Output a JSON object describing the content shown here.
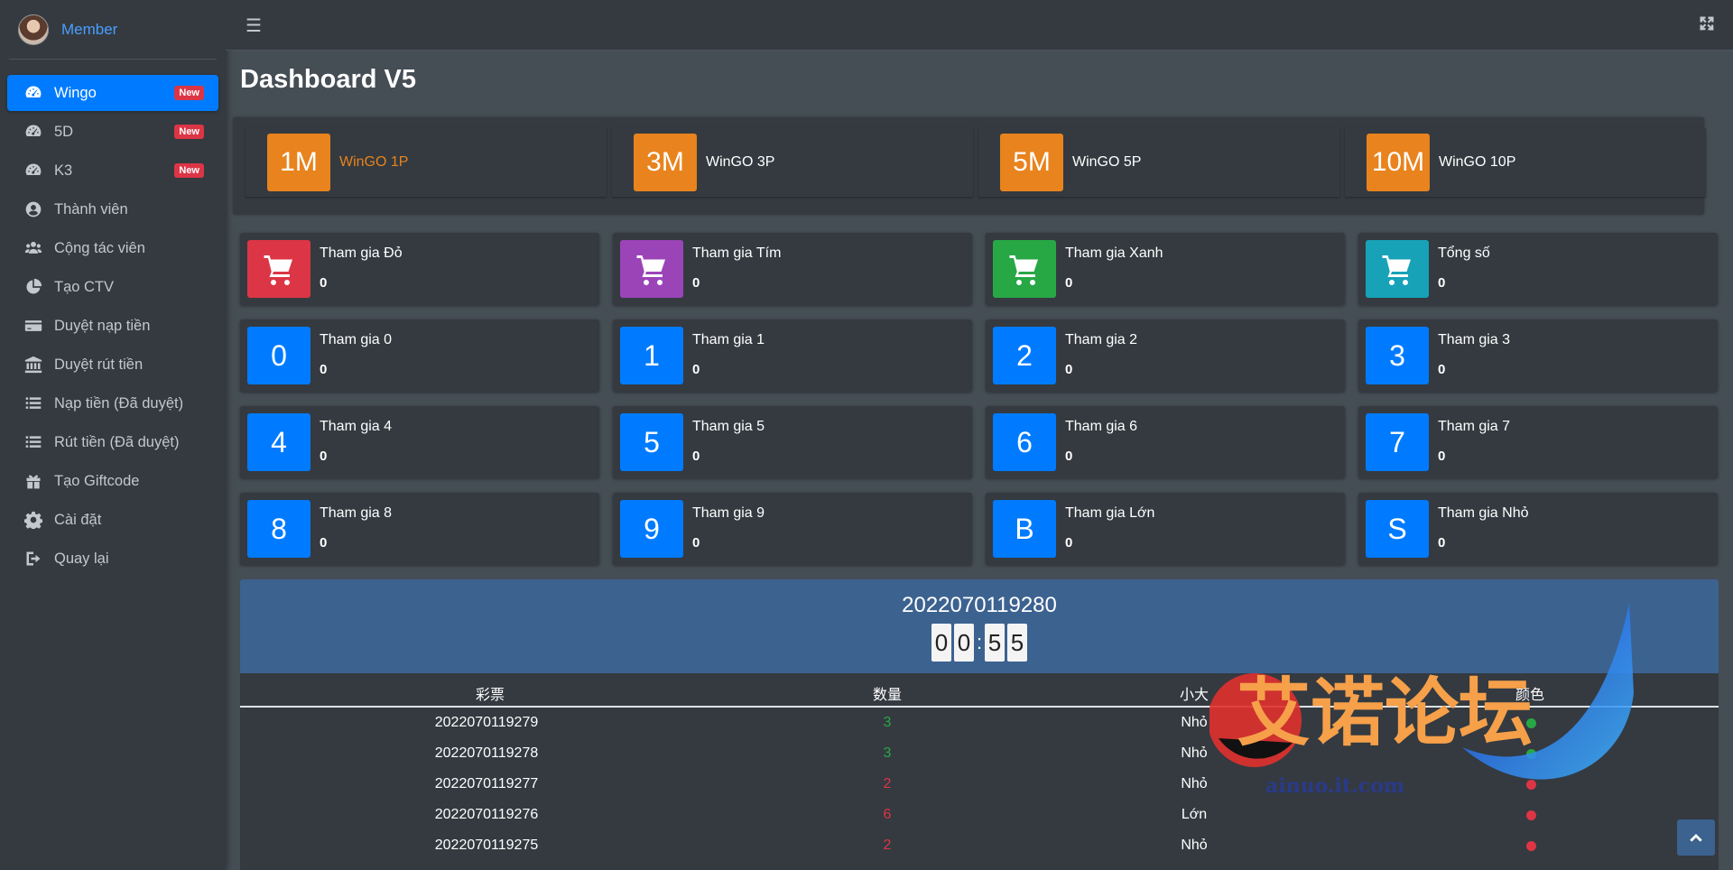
{
  "sidebar": {
    "user_name": "Member",
    "items": [
      {
        "label": "Wingo",
        "badge": "New",
        "icon": "dashboard-icon"
      },
      {
        "label": "5D",
        "badge": "New",
        "icon": "dashboard-icon"
      },
      {
        "label": "K3",
        "badge": "New",
        "icon": "dashboard-icon"
      },
      {
        "label": "Thành viên",
        "icon": "user-circle-icon"
      },
      {
        "label": "Cộng tác viên",
        "icon": "users-icon"
      },
      {
        "label": "Tạo CTV",
        "icon": "pie-chart-icon"
      },
      {
        "label": "Duyệt nạp tiền",
        "icon": "credit-card-icon"
      },
      {
        "label": "Duyệt rút tiền",
        "icon": "bank-icon"
      },
      {
        "label": "Nạp tiền (Đã duyệt)",
        "icon": "list-icon"
      },
      {
        "label": "Rút tiền (Đã duyệt)",
        "icon": "list-icon"
      },
      {
        "label": "Tạo Giftcode",
        "icon": "gift-icon"
      },
      {
        "label": "Cài đặt",
        "icon": "gear-icon"
      },
      {
        "label": "Quay lại",
        "icon": "sign-out-icon"
      }
    ]
  },
  "page": {
    "title": "Dashboard V5"
  },
  "games": [
    {
      "box": "1M",
      "label": "WinGO 1P",
      "active": true
    },
    {
      "box": "3M",
      "label": "WinGO 3P",
      "active": false
    },
    {
      "box": "5M",
      "label": "WinGO 5P",
      "active": false
    },
    {
      "box": "10M",
      "label": "WinGO 10P",
      "active": false
    }
  ],
  "color_cards": [
    {
      "title": "Tham gia Đỏ",
      "value": "0",
      "color": "#dc3545"
    },
    {
      "title": "Tham gia Tím",
      "value": "0",
      "color": "#9b44b8"
    },
    {
      "title": "Tham gia Xanh",
      "value": "0",
      "color": "#28a745"
    },
    {
      "title": "Tổng số",
      "value": "0",
      "color": "#17a2b8"
    }
  ],
  "number_cards": [
    {
      "box": "0",
      "title": "Tham gia 0",
      "value": "0"
    },
    {
      "box": "1",
      "title": "Tham gia 1",
      "value": "0"
    },
    {
      "box": "2",
      "title": "Tham gia 2",
      "value": "0"
    },
    {
      "box": "3",
      "title": "Tham gia 3",
      "value": "0"
    },
    {
      "box": "4",
      "title": "Tham gia 4",
      "value": "0"
    },
    {
      "box": "5",
      "title": "Tham gia 5",
      "value": "0"
    },
    {
      "box": "6",
      "title": "Tham gia 6",
      "value": "0"
    },
    {
      "box": "7",
      "title": "Tham gia 7",
      "value": "0"
    },
    {
      "box": "8",
      "title": "Tham gia 8",
      "value": "0"
    },
    {
      "box": "9",
      "title": "Tham gia 9",
      "value": "0"
    },
    {
      "box": "B",
      "title": "Tham gia Lớn",
      "value": "0"
    },
    {
      "box": "S",
      "title": "Tham gia Nhỏ",
      "value": "0"
    }
  ],
  "round": {
    "number": "2022070119280",
    "timer": [
      "0",
      "0",
      "5",
      "5"
    ]
  },
  "table": {
    "headers": [
      "彩票",
      "数量",
      "小大",
      "颜色"
    ],
    "rows": [
      {
        "period": "2022070119279",
        "number": "3",
        "size": "Nhỏ",
        "color": "#28a745"
      },
      {
        "period": "2022070119278",
        "number": "3",
        "size": "Nhỏ",
        "color": "#28a745"
      },
      {
        "period": "2022070119277",
        "number": "2",
        "size": "Nhỏ",
        "color": "#dc3545"
      },
      {
        "period": "2022070119276",
        "number": "6",
        "size": "Lớn",
        "color": "#dc3545"
      },
      {
        "period": "2022070119275",
        "number": "2",
        "size": "Nhỏ",
        "color": "#dc3545"
      }
    ]
  },
  "watermark": {
    "title": "艾诺论坛",
    "url": "ainuo.it.com"
  },
  "colors": {
    "accent": "#007bff",
    "orange": "#e8831d",
    "green": "#28a745",
    "red": "#dc3545",
    "panel": "#3c6290"
  }
}
